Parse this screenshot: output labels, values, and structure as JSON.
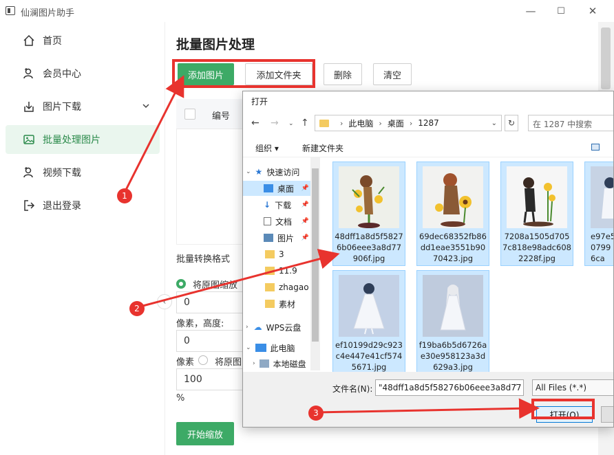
{
  "app": {
    "title": "仙澜图片助手"
  },
  "window_controls": {
    "minimize": "—",
    "maximize": "☐",
    "close": "✕"
  },
  "sidebar": {
    "items": [
      {
        "label": "首页"
      },
      {
        "label": "会员中心"
      },
      {
        "label": "图片下载"
      },
      {
        "label": "批量处理图片"
      },
      {
        "label": "视频下载"
      },
      {
        "label": "退出登录"
      }
    ]
  },
  "main": {
    "title": "批量图片处理",
    "buttons": {
      "add_image": "添加图片",
      "add_folder": "添加文件夹",
      "delete": "删除",
      "clear": "清空"
    },
    "table": {
      "col_number": "编号"
    },
    "convert_label": "批量转换格式",
    "radio_label": "将原图缩放",
    "width_value": "0",
    "pixel_height_label": "像素，高度:",
    "height_value": "0",
    "pixel_label": "像素",
    "radio2_label": "将原图",
    "percent_value": "100",
    "percent_unit": "%",
    "start_button": "开始缩放"
  },
  "dialog": {
    "title": "打开",
    "breadcrumb": [
      "此电脑",
      "桌面",
      "1287"
    ],
    "search_placeholder": "在 1287 中搜索",
    "toolbar": {
      "organize": "组织 ▾",
      "new_folder": "新建文件夹"
    },
    "tree": [
      {
        "label": "快速访问"
      },
      {
        "label": "桌面"
      },
      {
        "label": "下载"
      },
      {
        "label": "文档"
      },
      {
        "label": "图片"
      },
      {
        "label": "3"
      },
      {
        "label": "11.9"
      },
      {
        "label": "zhagao"
      },
      {
        "label": "素材"
      },
      {
        "label": "WPS云盘"
      },
      {
        "label": "此电脑"
      },
      {
        "label": "本地磁盘"
      }
    ],
    "files": [
      {
        "name": "48dff1a8d5f58276b06eee3a8d77906f.jpg"
      },
      {
        "name": "69dec68352fb86dd1eae3551b9070423.jpg"
      },
      {
        "name": "7208a1505d7057c818e98adc6082228f.jpg"
      },
      {
        "name": "e97e5\n0799\n6ca"
      },
      {
        "name": "ef10199d29c923c4e447e41cf5745671.jpg"
      },
      {
        "name": "f19ba6b5d6726ae30e958123a3d629a3.jpg"
      }
    ],
    "filename_label": "文件名(N):",
    "filename_value": "\"48dff1a8d5f58276b06eee3a8d77",
    "filter_value": "All Files (*.*)",
    "open_button": "打开(O)"
  },
  "annotations": [
    "1",
    "2",
    "3"
  ],
  "colors": {
    "accent_green": "#3daa66",
    "annotation_red": "#e8332e",
    "selection_blue": "#cce8ff"
  }
}
